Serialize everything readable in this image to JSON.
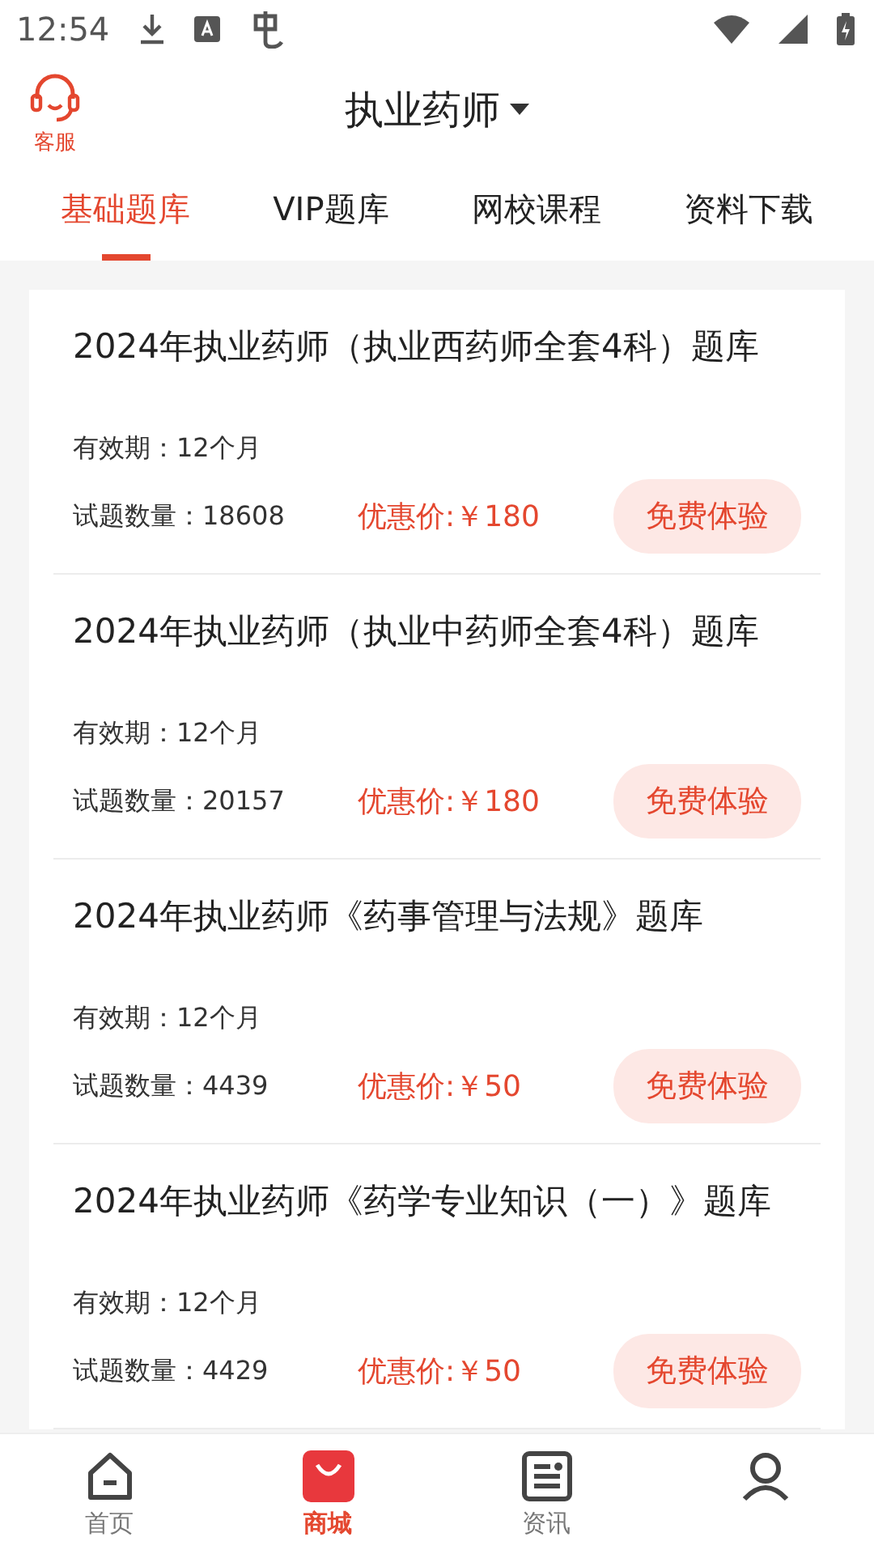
{
  "status_bar": {
    "time": "12:54"
  },
  "header": {
    "service_label": "客服",
    "title": "执业药师"
  },
  "tabs": [
    {
      "label": "基础题库",
      "selected": true
    },
    {
      "label": "VIP题库",
      "selected": false
    },
    {
      "label": "网校课程",
      "selected": false
    },
    {
      "label": "资料下载",
      "selected": false
    }
  ],
  "products": [
    {
      "title": "2024年执业药师（执业西药师全套4科）题库",
      "validity": "有效期：12个月",
      "count": "试题数量：18608",
      "price": "优惠价:￥180",
      "button": "免费体验"
    },
    {
      "title": "2024年执业药师（执业中药师全套4科）题库",
      "validity": "有效期：12个月",
      "count": "试题数量：20157",
      "price": "优惠价:￥180",
      "button": "免费体验"
    },
    {
      "title": "2024年执业药师《药事管理与法规》题库",
      "validity": "有效期：12个月",
      "count": "试题数量：4439",
      "price": "优惠价:￥50",
      "button": "免费体验"
    },
    {
      "title": "2024年执业药师《药学专业知识（一）》题库",
      "validity": "有效期：12个月",
      "count": "试题数量：4429",
      "price": "优惠价:￥50",
      "button": "免费体验"
    }
  ],
  "bottom_nav": [
    {
      "kind": "home",
      "label": "首页",
      "selected": false
    },
    {
      "kind": "shop",
      "label": "商城",
      "selected": true
    },
    {
      "kind": "news",
      "label": "资讯",
      "selected": false
    },
    {
      "kind": "profile",
      "selected": false
    }
  ]
}
